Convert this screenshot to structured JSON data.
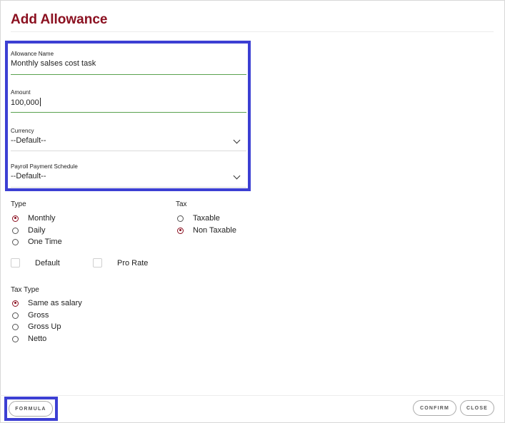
{
  "dialog": {
    "title": "Add Allowance"
  },
  "fields": {
    "allowance_name": {
      "label": "Allowance Name",
      "value": "Monthly salses cost task"
    },
    "amount": {
      "label": "Amount",
      "value": "100,000"
    },
    "currency": {
      "label": "Currency",
      "value": "--Default--"
    },
    "payroll_schedule": {
      "label": "Payroll Payment Schedule",
      "value": "--Default--"
    }
  },
  "type": {
    "label": "Type",
    "options": [
      {
        "label": "Monthly",
        "selected": true
      },
      {
        "label": "Daily",
        "selected": false
      },
      {
        "label": "One Time",
        "selected": false
      }
    ]
  },
  "tax": {
    "label": "Tax",
    "options": [
      {
        "label": "Taxable",
        "selected": false
      },
      {
        "label": "Non Taxable",
        "selected": true
      }
    ]
  },
  "checkboxes": [
    {
      "label": "Default",
      "checked": false
    },
    {
      "label": "Pro Rate",
      "checked": false
    }
  ],
  "tax_type": {
    "label": "Tax Type",
    "options": [
      {
        "label": "Same as salary",
        "selected": true
      },
      {
        "label": "Gross",
        "selected": false
      },
      {
        "label": "Gross Up",
        "selected": false
      },
      {
        "label": "Netto",
        "selected": false
      }
    ]
  },
  "buttons": {
    "formula": "FORMULA",
    "confirm": "CONFIRM",
    "close": "CLOSE"
  },
  "colors": {
    "accent": "#8b1020",
    "highlight": "#3c3fd3",
    "underline_active": "#5aa24f"
  }
}
